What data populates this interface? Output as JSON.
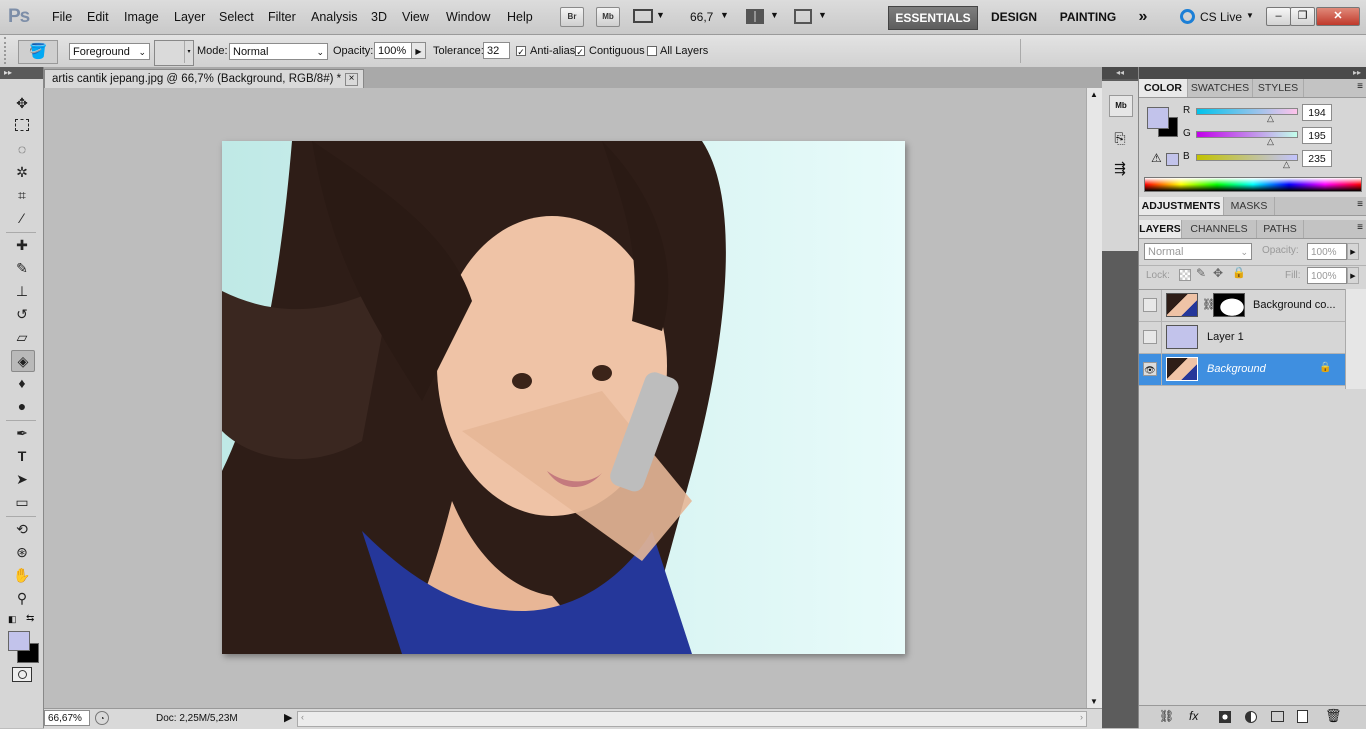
{
  "app": {
    "logo": "Ps",
    "menus": [
      "File",
      "Edit",
      "Image",
      "Layer",
      "Select",
      "Filter",
      "Analysis",
      "3D",
      "View",
      "Window",
      "Help"
    ],
    "bridge_label": "Br",
    "minibridge_label": "Mb",
    "zoom_value": "66,7",
    "workspaces": [
      "ESSENTIALS",
      "DESIGN",
      "PAINTING"
    ],
    "more_workspaces": "»",
    "cslive": "CS Live"
  },
  "options": {
    "fill_source": "Foreground",
    "mode_label": "Mode:",
    "mode_value": "Normal",
    "opacity_label": "Opacity:",
    "opacity_value": "100%",
    "tolerance_label": "Tolerance:",
    "tolerance_value": "32",
    "antialias_label": "Anti-alias",
    "contiguous_label": "Contiguous",
    "all_layers_label": "All Layers"
  },
  "document": {
    "tab_title": "artis cantik jepang.jpg @ 66,7% (Background, RGB/8#) *",
    "close_glyph": "×"
  },
  "status": {
    "zoom": "66,67%",
    "doc_info": "Doc: 2,25M/5,23M"
  },
  "color_panel": {
    "tabs": [
      "COLOR",
      "SWATCHES",
      "STYLES"
    ],
    "channels": [
      {
        "label": "R",
        "value": "194"
      },
      {
        "label": "G",
        "value": "195"
      },
      {
        "label": "B",
        "value": "235"
      }
    ],
    "foreground": "#c2c3eb",
    "background": "#000000"
  },
  "adjustments_panel": {
    "tabs": [
      "ADJUSTMENTS",
      "MASKS"
    ]
  },
  "layers_panel": {
    "tabs": [
      "LAYERS",
      "CHANNELS",
      "PATHS"
    ],
    "blend_mode": "Normal",
    "opacity_label": "Opacity:",
    "opacity_value": "100%",
    "lock_label": "Lock:",
    "fill_label": "Fill:",
    "fill_value": "100%",
    "layers": [
      {
        "name": "Background co...",
        "visible": false,
        "selected": false,
        "has_mask": true
      },
      {
        "name": "Layer 1",
        "visible": false,
        "selected": false,
        "has_mask": false
      },
      {
        "name": "Background",
        "visible": true,
        "selected": true,
        "has_mask": false
      }
    ]
  }
}
